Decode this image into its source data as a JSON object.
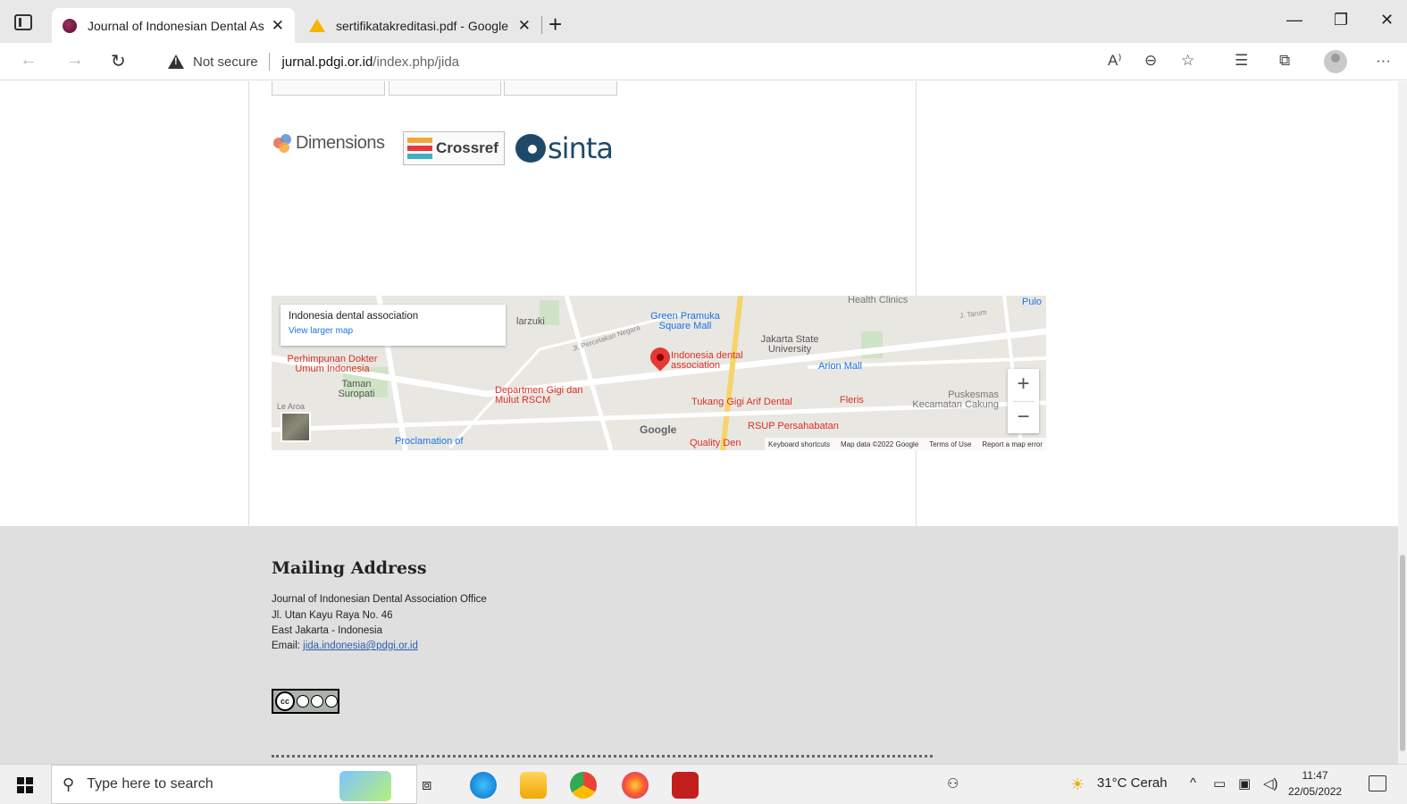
{
  "browser": {
    "tabs": [
      {
        "title": "Journal of Indonesian Dental Ass",
        "active": true
      },
      {
        "title": "sertifikatakreditasi.pdf - Google ",
        "active": false
      }
    ],
    "tab_close": "✕",
    "new_tab": "+",
    "security_label": "Not secure",
    "url_host": "jurnal.pdgi.or.id",
    "url_path": "/index.php/jida"
  },
  "indexing_logos": {
    "dimensions": "Dimensions",
    "crossref": "Crossref",
    "sinta": "sinta"
  },
  "map": {
    "place_name": "Indonesia dental association",
    "view_larger": "View larger map",
    "labels": {
      "health_clinics": "Health Clinics",
      "pulo": "Pulo",
      "marzuki": "larzuki",
      "green_pramuka": "Green Pramuka Square Mall",
      "jakarta_state": "Jakarta State University",
      "perhimpunan": "Perhimpunan Dokter Umum Indonesia",
      "main_pin": "Indonesia dental association",
      "arion": "Arion Mall",
      "taman": "Taman Suropati",
      "departmen": "Departmen Gigi dan Mulut RSCM",
      "tukang": "Tukang Gigi Arif Dental",
      "fleris": "Fleris",
      "puskesmas": "Puskesmas Kecamatan Cakung",
      "rsup": "RSUP Persahabatan",
      "proclamation": "Proclamation of",
      "quality": "Quality Den",
      "le_aroa": "Le Aroa",
      "perusahaan": "Jl. Percetakan Negara",
      "j_tarum": "J. Tarum",
      "google": "Google"
    },
    "zoom_in": "+",
    "zoom_out": "−",
    "footer": {
      "shortcuts": "Keyboard shortcuts",
      "map_data": "Map data ©2022 Google",
      "terms": "Terms of Use",
      "report": "Report a map error"
    }
  },
  "footer": {
    "title": "Mailing Address",
    "lines": [
      "Journal of Indonesian Dental Association Office",
      "Jl. Utan Kayu Raya No. 46",
      "East Jakarta - Indonesia"
    ],
    "email_label": "Email: ",
    "email": "jida.indonesia@pdgi.or.id",
    "cc_label": "cc"
  },
  "taskbar": {
    "search_placeholder": "Type here to search",
    "weather": "31°C  Cerah",
    "time": "11:47",
    "date": "22/05/2022"
  },
  "colors": {
    "accent_link": "#2a5db0",
    "map_pin": "#e53935",
    "footer_bg": "#dfdfdf"
  }
}
